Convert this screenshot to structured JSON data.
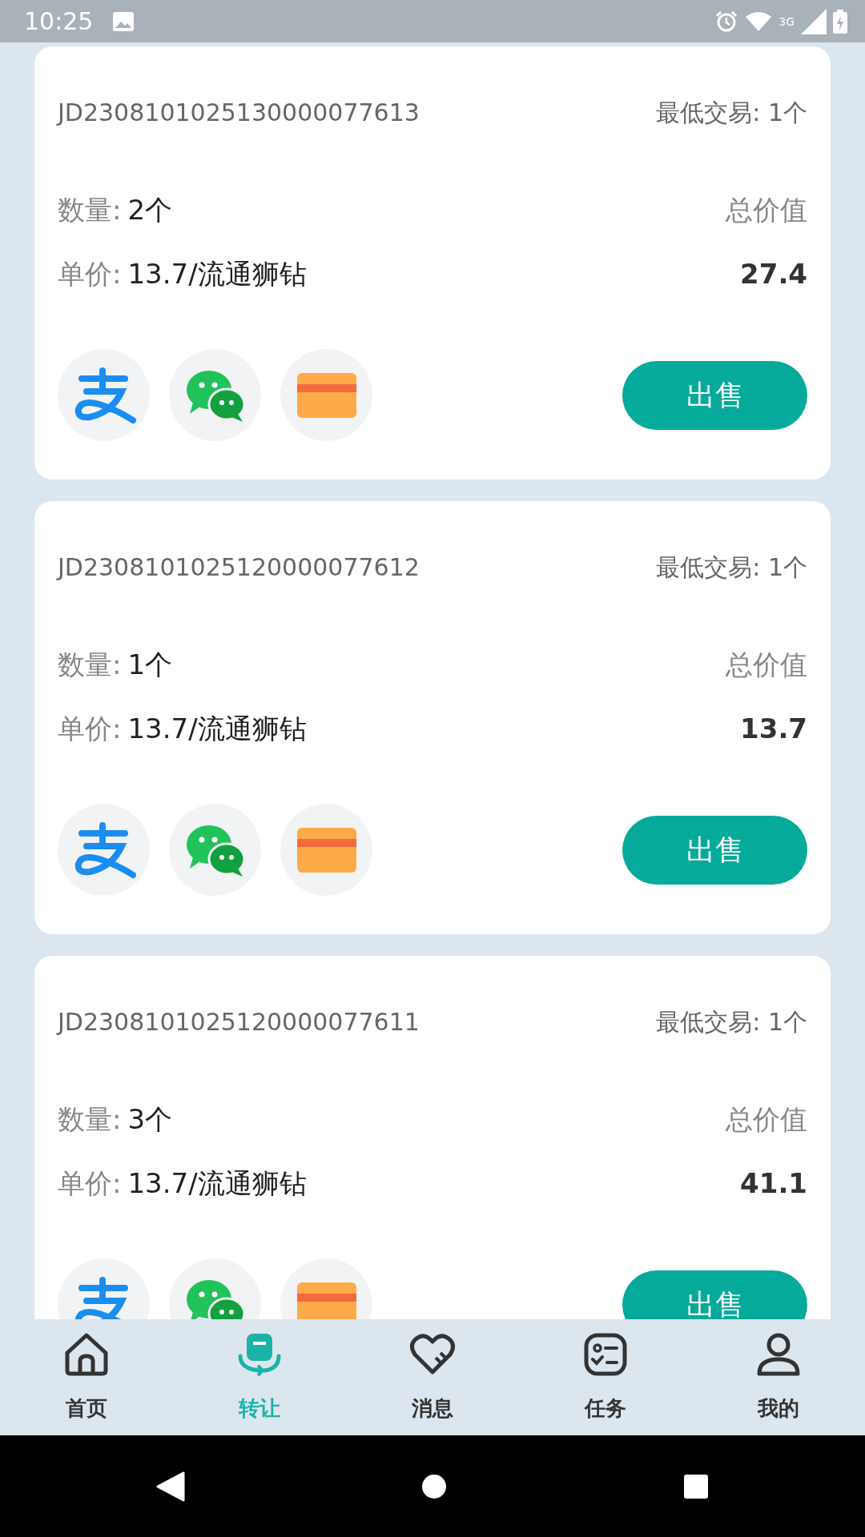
{
  "status_bar": {
    "time": "10:25",
    "network": "3G"
  },
  "orders": [
    {
      "id": "JD2308101025130000077613",
      "min_trade": "最低交易: 1个",
      "quantity_label": "数量:",
      "quantity": "2个",
      "price_label": "单价:",
      "unit_price": "13.7/流通狮钻",
      "total_label": "总价值",
      "total": "27.4",
      "payment_methods": [
        {
          "kind": "alipay"
        },
        {
          "kind": "wechat"
        },
        {
          "kind": "card"
        }
      ],
      "action": "出售"
    },
    {
      "id": "JD2308101025120000077612",
      "min_trade": "最低交易: 1个",
      "quantity_label": "数量:",
      "quantity": "1个",
      "price_label": "单价:",
      "unit_price": "13.7/流通狮钻",
      "total_label": "总价值",
      "total": "13.7",
      "payment_methods": [
        {
          "kind": "alipay"
        },
        {
          "kind": "wechat"
        },
        {
          "kind": "card"
        }
      ],
      "action": "出售"
    },
    {
      "id": "JD2308101025120000077611",
      "min_trade": "最低交易: 1个",
      "quantity_label": "数量:",
      "quantity": "3个",
      "price_label": "单价:",
      "unit_price": "13.7/流通狮钻",
      "total_label": "总价值",
      "total": "41.1",
      "payment_methods": [
        {
          "kind": "alipay"
        },
        {
          "kind": "wechat"
        },
        {
          "kind": "card"
        }
      ],
      "action": "出售"
    }
  ],
  "nav": [
    {
      "kind": "home",
      "label": "首页",
      "selected": false
    },
    {
      "kind": "transfer",
      "label": "转让",
      "selected": true
    },
    {
      "kind": "message",
      "label": "消息",
      "selected": false
    },
    {
      "kind": "task",
      "label": "任务",
      "selected": false
    },
    {
      "kind": "profile",
      "label": "我的",
      "selected": false
    }
  ]
}
